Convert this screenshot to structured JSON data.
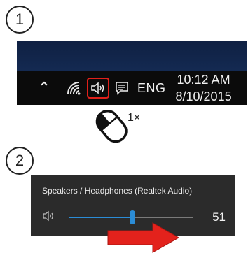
{
  "steps": {
    "step1": "1",
    "step2": "2"
  },
  "taskbar": {
    "icons": {
      "chevron": "chevron-up-icon",
      "wifi": "wifi-icon",
      "volume": "speaker-volume-icon",
      "action_center": "action-center-icon"
    },
    "language": "ENG",
    "clock": {
      "time": "10:12 AM",
      "date": "8/10/2015"
    },
    "highlight_color": "#e0201a"
  },
  "instruction": {
    "click_count": "1×"
  },
  "volume_flyout": {
    "device": "Speakers / Headphones (Realtek Audio)",
    "level": 51,
    "slider_fraction": 0.51,
    "accent": "#2b8cd6"
  },
  "arrow": {
    "color": "#e3221c"
  }
}
